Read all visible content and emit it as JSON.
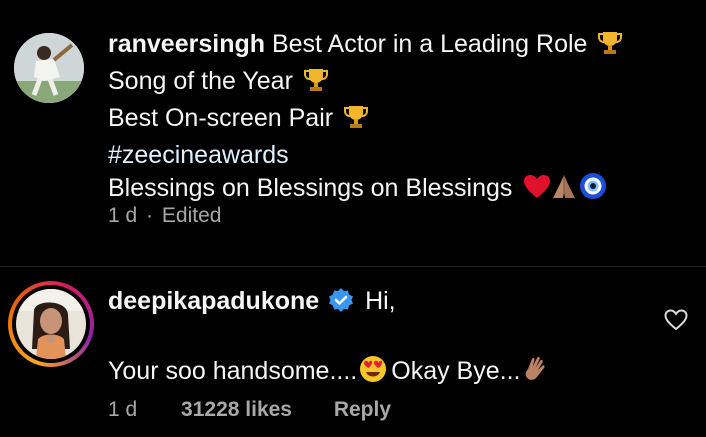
{
  "comment1": {
    "username": "ranveersingh",
    "lines": [
      "Best Actor in a Leading Role",
      "Song of the Year",
      "Best On-screen Pair",
      "#zeecineawards",
      "Blessings on Blessings on Blessings"
    ],
    "time": "1 d",
    "separator": "·",
    "edited": "Edited",
    "icons": [
      "trophy-icon",
      "heart-icon",
      "folded-hands-icon",
      "nazar-amulet-icon"
    ]
  },
  "comment2": {
    "username": "deepikapadukone",
    "greeting": "Hi,",
    "body_part1": "Your soo handsome....",
    "body_part2": "Okay Bye...",
    "time": "1 d",
    "likes": "31228 likes",
    "reply_label": "Reply",
    "icons": [
      "verified-badge-icon",
      "heart-eyes-emoji-icon",
      "waving-hand-icon",
      "like-heart-icon"
    ]
  },
  "colors": {
    "background": "#000000",
    "text": "#f5f5f5",
    "meta": "#a8a8a8",
    "hashtag": "#e0f1ff",
    "verified": "#3897f0"
  }
}
